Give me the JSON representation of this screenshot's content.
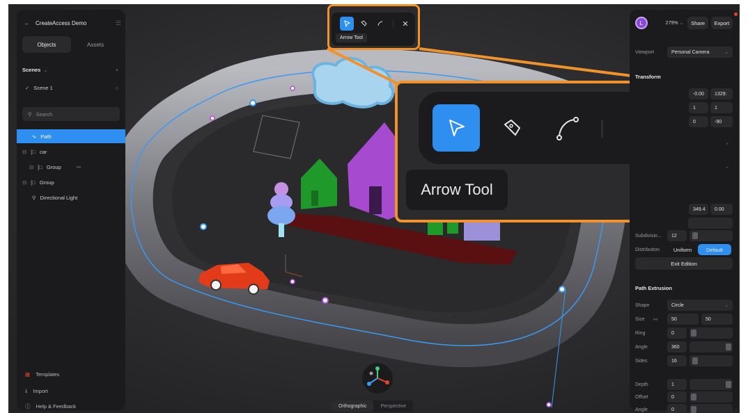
{
  "left_panel": {
    "title": "CreateAccess Demo",
    "tabs": [
      {
        "label": "Objects"
      },
      {
        "label": "Assets"
      }
    ],
    "scenes_label": "Scenes",
    "scene_item": "Scene 1",
    "search_placeholder": "Search",
    "tree": [
      {
        "label": "Path"
      },
      {
        "label": "car"
      },
      {
        "label": "Group"
      },
      {
        "label": "Group"
      },
      {
        "label": "Directional Light"
      }
    ],
    "bottom": [
      {
        "label": "Templates"
      },
      {
        "label": "Import"
      },
      {
        "label": "Help & Feedback"
      }
    ]
  },
  "toolbar": {
    "tooltip": "Arrow Tool"
  },
  "callout": {
    "tooltip": "Arrow Tool"
  },
  "view_toggle": {
    "options": [
      "Orthographic",
      "Perspective"
    ]
  },
  "right_panel": {
    "avatar_letter": "L",
    "zoom": "279%",
    "share_label": "Share",
    "export_label": "Export",
    "viewport_label": "Viewport",
    "viewport_value": "Personal Camera",
    "transform_label": "Transform",
    "transform_row1": [
      "-0.00",
      "1329:"
    ],
    "transform_row2": [
      "1",
      "1"
    ],
    "transform_row3": [
      "0",
      "-90"
    ],
    "pos_values": [
      "349.4",
      "0.00"
    ],
    "subdivision_label": "Subdivisio...",
    "subdivision_value": "12",
    "distribution_label": "Distribution",
    "distribution_options": [
      "Uniform",
      "Default"
    ],
    "exit_edition_label": "Exit Edition",
    "path_extrusion_label": "Path Extrusion",
    "shape_label": "Shape",
    "shape_value": "Circle",
    "size_label": "Size",
    "size_x": "50",
    "size_y": "50",
    "ring_label": "Ring",
    "ring_value": "0",
    "angle_label": "Angle",
    "angle_value": "360",
    "sides_label": "Sides",
    "sides_value": "16",
    "depth_label": "Depth",
    "depth_value": "1",
    "offset_label": "Offset",
    "offset_value": "0",
    "angle2_label": "Angle",
    "angle2_value": "0"
  },
  "colors": {
    "accent": "#2f8ff0",
    "highlight": "#f2922a",
    "panel": "#1b1b1d"
  }
}
